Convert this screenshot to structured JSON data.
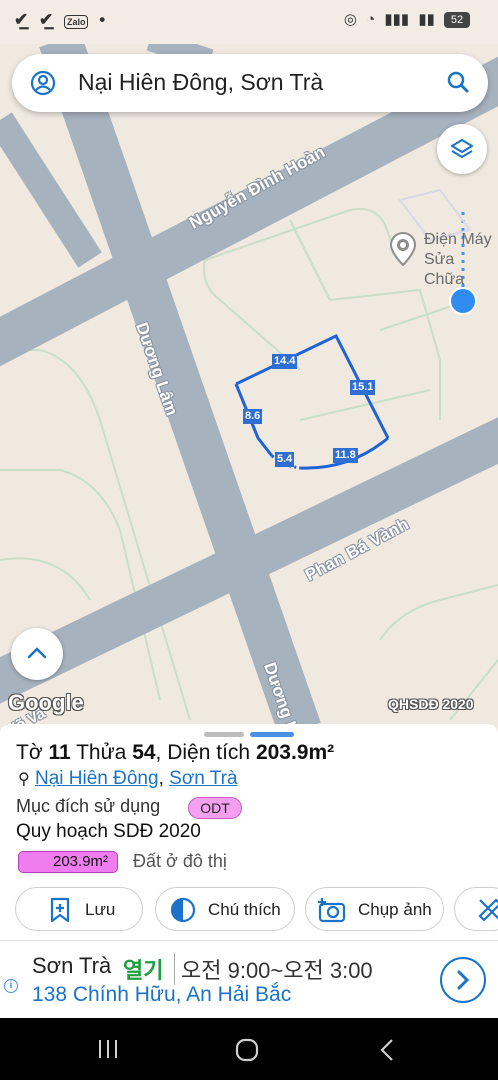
{
  "status_bar": {
    "left_icons": [
      "check-icon",
      "check-icon",
      "zalo-icon",
      "dot-icon"
    ],
    "zalo_label": "Zalo",
    "battery": "52"
  },
  "search": {
    "query": "Nại Hiên Đông, Sơn Trà"
  },
  "map": {
    "roads": {
      "nguyen_dinh_hoan": "Nguyễn Đình Hoàn",
      "duong_lam_upper": "Dương Lâm",
      "phan_ba_vanh": "Phan Bá Vành",
      "duong_lam_lower": "Dương L",
      "bottom_left": "Võ Va"
    },
    "poi": {
      "line1": "Điện Máy",
      "line2": "Sửa Chữa"
    },
    "parcel_edges": [
      "14.4",
      "15.1",
      "8.6",
      "5.4",
      "11.8"
    ],
    "watermark": "Google",
    "layer_tag": "QHSDĐ 2020",
    "accent_color": "#2f6fd4"
  },
  "sheet": {
    "title_pre": "Tờ ",
    "sheet_no": "11",
    "title_mid": " Thửa ",
    "parcel_no": "54",
    "title_area_label": ", Diện tích ",
    "area": "203.9m²",
    "addr_ward": "Nại Hiên Đông",
    "addr_sep": ", ",
    "addr_district": "Sơn Trà",
    "purpose_label": "Mục đích sử dụng",
    "purpose_code": "ODT",
    "plan_label": "Quy hoạch SDĐ 2020",
    "plan_area": "203.9m²",
    "plan_use": "Đất ở đô thị",
    "actions": {
      "save": "Lưu",
      "legend": "Chú thích",
      "photo": "Chụp ảnh"
    }
  },
  "ad": {
    "name": "Sơn Trà",
    "status": "열기",
    "hours": "오전 9:00~오전 3:00",
    "address": "138 Chính Hữu, An Hải Bắc"
  }
}
